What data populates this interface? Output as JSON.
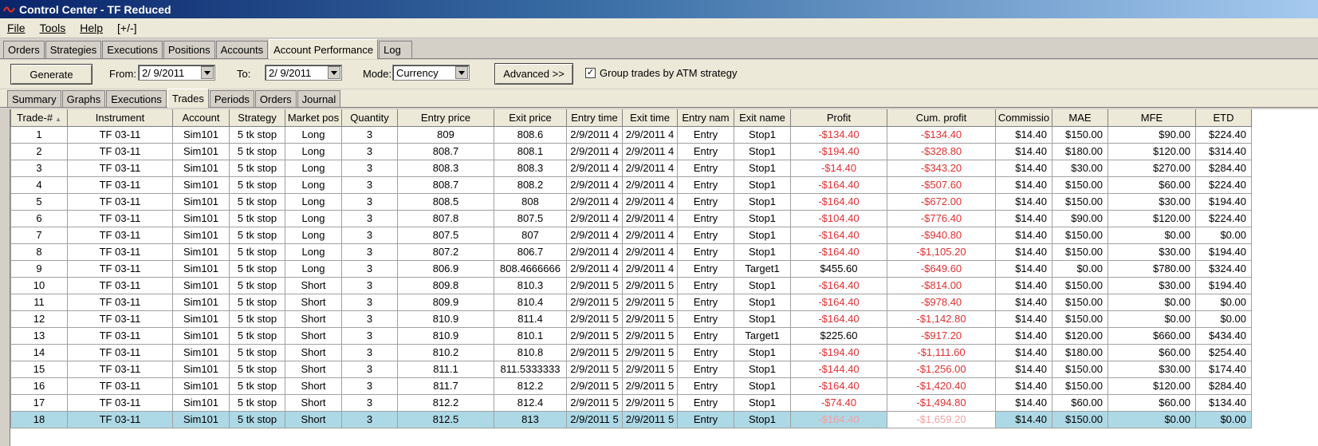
{
  "window": {
    "title": "Control Center - TF Reduced"
  },
  "menu": [
    "File",
    "Tools",
    "Help",
    "[+/-]"
  ],
  "main_tabs": [
    "Orders",
    "Strategies",
    "Executions",
    "Positions",
    "Accounts",
    "Account Performance",
    "Log"
  ],
  "active_main_tab": "Account Performance",
  "toolbar": {
    "generate_label": "Generate",
    "from_label": "From:",
    "from_value": "2/ 9/2011",
    "to_label": "To:",
    "to_value": "2/ 9/2011",
    "mode_label": "Mode:",
    "mode_value": "Currency",
    "advanced_label": "Advanced >>",
    "group_label": "Group trades by ATM strategy",
    "group_checked": true
  },
  "sub_tabs": [
    "Summary",
    "Graphs",
    "Executions",
    "Trades",
    "Periods",
    "Orders",
    "Journal"
  ],
  "active_sub_tab": "Trades",
  "columns": [
    "Trade-#",
    "Instrument",
    "Account",
    "Strategy",
    "Market pos",
    "Quantity",
    "Entry price",
    "Exit price",
    "Entry time",
    "Exit time",
    "Entry nam",
    "Exit name",
    "Profit",
    "Cum. profit",
    "Commissio",
    "MAE",
    "MFE",
    "ETD"
  ],
  "rows": [
    [
      "1",
      "TF 03-11",
      "Sim101",
      "5 tk stop",
      "Long",
      "3",
      "809",
      "808.6",
      "2/9/2011 4",
      "2/9/2011 4",
      "Entry",
      "Stop1",
      "-$134.40",
      "-$134.40",
      "$14.40",
      "$150.00",
      "$90.00",
      "$224.40"
    ],
    [
      "2",
      "TF 03-11",
      "Sim101",
      "5 tk stop",
      "Long",
      "3",
      "808.7",
      "808.1",
      "2/9/2011 4",
      "2/9/2011 4",
      "Entry",
      "Stop1",
      "-$194.40",
      "-$328.80",
      "$14.40",
      "$180.00",
      "$120.00",
      "$314.40"
    ],
    [
      "3",
      "TF 03-11",
      "Sim101",
      "5 tk stop",
      "Long",
      "3",
      "808.3",
      "808.3",
      "2/9/2011 4",
      "2/9/2011 4",
      "Entry",
      "Stop1",
      "-$14.40",
      "-$343.20",
      "$14.40",
      "$30.00",
      "$270.00",
      "$284.40"
    ],
    [
      "4",
      "TF 03-11",
      "Sim101",
      "5 tk stop",
      "Long",
      "3",
      "808.7",
      "808.2",
      "2/9/2011 4",
      "2/9/2011 4",
      "Entry",
      "Stop1",
      "-$164.40",
      "-$507.60",
      "$14.40",
      "$150.00",
      "$60.00",
      "$224.40"
    ],
    [
      "5",
      "TF 03-11",
      "Sim101",
      "5 tk stop",
      "Long",
      "3",
      "808.5",
      "808",
      "2/9/2011 4",
      "2/9/2011 4",
      "Entry",
      "Stop1",
      "-$164.40",
      "-$672.00",
      "$14.40",
      "$150.00",
      "$30.00",
      "$194.40"
    ],
    [
      "6",
      "TF 03-11",
      "Sim101",
      "5 tk stop",
      "Long",
      "3",
      "807.8",
      "807.5",
      "2/9/2011 4",
      "2/9/2011 4",
      "Entry",
      "Stop1",
      "-$104.40",
      "-$776.40",
      "$14.40",
      "$90.00",
      "$120.00",
      "$224.40"
    ],
    [
      "7",
      "TF 03-11",
      "Sim101",
      "5 tk stop",
      "Long",
      "3",
      "807.5",
      "807",
      "2/9/2011 4",
      "2/9/2011 4",
      "Entry",
      "Stop1",
      "-$164.40",
      "-$940.80",
      "$14.40",
      "$150.00",
      "$0.00",
      "$0.00"
    ],
    [
      "8",
      "TF 03-11",
      "Sim101",
      "5 tk stop",
      "Long",
      "3",
      "807.2",
      "806.7",
      "2/9/2011 4",
      "2/9/2011 4",
      "Entry",
      "Stop1",
      "-$164.40",
      "-$1,105.20",
      "$14.40",
      "$150.00",
      "$30.00",
      "$194.40"
    ],
    [
      "9",
      "TF 03-11",
      "Sim101",
      "5 tk stop",
      "Long",
      "3",
      "806.9",
      "808.4666666",
      "2/9/2011 4",
      "2/9/2011 4",
      "Entry",
      "Target1",
      "$455.60",
      "-$649.60",
      "$14.40",
      "$0.00",
      "$780.00",
      "$324.40"
    ],
    [
      "10",
      "TF 03-11",
      "Sim101",
      "5 tk stop",
      "Short",
      "3",
      "809.8",
      "810.3",
      "2/9/2011 5",
      "2/9/2011 5",
      "Entry",
      "Stop1",
      "-$164.40",
      "-$814.00",
      "$14.40",
      "$150.00",
      "$30.00",
      "$194.40"
    ],
    [
      "11",
      "TF 03-11",
      "Sim101",
      "5 tk stop",
      "Short",
      "3",
      "809.9",
      "810.4",
      "2/9/2011 5",
      "2/9/2011 5",
      "Entry",
      "Stop1",
      "-$164.40",
      "-$978.40",
      "$14.40",
      "$150.00",
      "$0.00",
      "$0.00"
    ],
    [
      "12",
      "TF 03-11",
      "Sim101",
      "5 tk stop",
      "Short",
      "3",
      "810.9",
      "811.4",
      "2/9/2011 5",
      "2/9/2011 5",
      "Entry",
      "Stop1",
      "-$164.40",
      "-$1,142.80",
      "$14.40",
      "$150.00",
      "$0.00",
      "$0.00"
    ],
    [
      "13",
      "TF 03-11",
      "Sim101",
      "5 tk stop",
      "Short",
      "3",
      "810.9",
      "810.1",
      "2/9/2011 5",
      "2/9/2011 5",
      "Entry",
      "Target1",
      "$225.60",
      "-$917.20",
      "$14.40",
      "$120.00",
      "$660.00",
      "$434.40"
    ],
    [
      "14",
      "TF 03-11",
      "Sim101",
      "5 tk stop",
      "Short",
      "3",
      "810.2",
      "810.8",
      "2/9/2011 5",
      "2/9/2011 5",
      "Entry",
      "Stop1",
      "-$194.40",
      "-$1,111.60",
      "$14.40",
      "$180.00",
      "$60.00",
      "$254.40"
    ],
    [
      "15",
      "TF 03-11",
      "Sim101",
      "5 tk stop",
      "Short",
      "3",
      "811.1",
      "811.5333333",
      "2/9/2011 5",
      "2/9/2011 5",
      "Entry",
      "Stop1",
      "-$144.40",
      "-$1,256.00",
      "$14.40",
      "$150.00",
      "$30.00",
      "$174.40"
    ],
    [
      "16",
      "TF 03-11",
      "Sim101",
      "5 tk stop",
      "Short",
      "3",
      "811.7",
      "812.2",
      "2/9/2011 5",
      "2/9/2011 5",
      "Entry",
      "Stop1",
      "-$164.40",
      "-$1,420.40",
      "$14.40",
      "$150.00",
      "$120.00",
      "$284.40"
    ],
    [
      "17",
      "TF 03-11",
      "Sim101",
      "5 tk stop",
      "Short",
      "3",
      "812.2",
      "812.4",
      "2/9/2011 5",
      "2/9/2011 5",
      "Entry",
      "Stop1",
      "-$74.40",
      "-$1,494.80",
      "$14.40",
      "$60.00",
      "$60.00",
      "$134.40"
    ],
    [
      "18",
      "TF 03-11",
      "Sim101",
      "5 tk stop",
      "Short",
      "3",
      "812.5",
      "813",
      "2/9/2011 5",
      "2/9/2011 5",
      "Entry",
      "Stop1",
      "-$164.40",
      "-$1,659.20",
      "$14.40",
      "$150.00",
      "$0.00",
      "$0.00"
    ]
  ],
  "selected_row": "18",
  "colors": {
    "negative": "#e03030",
    "selection": "#add8e6"
  }
}
